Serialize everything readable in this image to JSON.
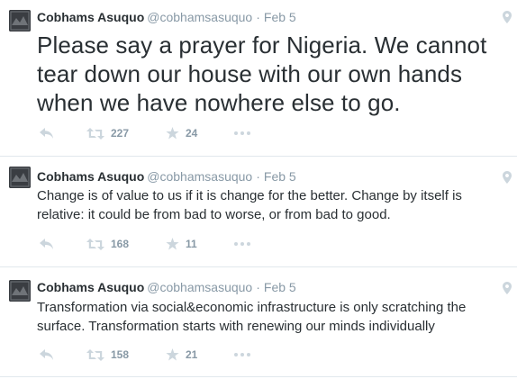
{
  "tweets": [
    {
      "fullname": "Cobhams Asuquo",
      "username": "@cobhamsasuquo",
      "separator": "·",
      "time": "Feb 5",
      "text": "Please say a prayer for Nigeria. We cannot tear down our house with our own hands when we have nowhere else to go.",
      "retweets": "227",
      "favorites": "24"
    },
    {
      "fullname": "Cobhams Asuquo",
      "username": "@cobhamsasuquo",
      "separator": "·",
      "time": "Feb 5",
      "text": "Change is of value to us if it is change for the better. Change by itself is relative: it could be from bad to worse, or from bad to good.",
      "retweets": "168",
      "favorites": "11"
    },
    {
      "fullname": "Cobhams Asuquo",
      "username": "@cobhamsasuquo",
      "separator": "·",
      "time": "Feb 5",
      "text": "Transformation via social&economic infrastructure is only scratching the surface. Transformation starts with renewing our minds individually",
      "retweets": "158",
      "favorites": "21"
    }
  ],
  "icons": {
    "avatar": "profile-photo",
    "geo": "location-pin-icon",
    "reply": "reply-arrow-icon",
    "retweet": "retweet-icon",
    "favorite": "star-icon",
    "more": "ellipsis-icon"
  },
  "colors": {
    "text": "#292f33",
    "muted": "#8899a6",
    "icon": "#ccd6dd",
    "divider": "#e1e8ed"
  }
}
